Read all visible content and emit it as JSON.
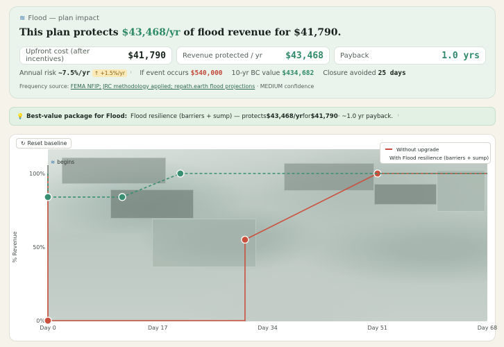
{
  "header": {
    "subtitle": "Flood — plan impact",
    "subtitle_icon": "wave-icon",
    "headline_pre": "This plan protects ",
    "headline_amount": "$43,468/yr",
    "headline_post": " of flood revenue for $41,790."
  },
  "stats": [
    {
      "label": "Upfront cost (after incentives)",
      "value": "$41,790"
    },
    {
      "label": "Revenue protected / yr",
      "value": "$43,468"
    },
    {
      "label": "Payback",
      "value": "1.0 yrs"
    }
  ],
  "metrics": {
    "annual_risk_label": "Annual risk",
    "annual_risk_value": "~7.5%/yr",
    "annual_risk_trend": "↑ +1.5%/yr",
    "event_label": "If event occurs",
    "event_value": "$540,000",
    "bc_label": "10-yr BC value",
    "bc_value": "$434,682",
    "closure_label": "Closure avoided",
    "closure_value": "25 days"
  },
  "source": {
    "prefix": "Frequency source: ",
    "link": "FEMA NFIP; JRC methodology applied; repath.earth flood projections",
    "suffix": " · MEDIUM confidence"
  },
  "banner": {
    "icon": "lightbulb-icon",
    "title": "Best-value package for Flood:",
    "text_pre": "Flood resilience (barriers + sump) — protects ",
    "amount": "$43,468/yr",
    "text_mid": " for ",
    "cost": "$41,790",
    "text_post": " · ~1.0 yr payback."
  },
  "chart_controls": {
    "reset_label": "Reset baseline",
    "reset_icon": "reset-icon"
  },
  "chart_data": {
    "type": "line",
    "xlabel": "",
    "ylabel": "% Revenue",
    "x_ticks": [
      "Day 0",
      "Day 17",
      "Day 34",
      "Day 51",
      "Day 68"
    ],
    "y_ticks": [
      "100%",
      "50%",
      "0%"
    ],
    "xlim": [
      0,
      68
    ],
    "ylim": [
      0,
      100
    ],
    "grid": false,
    "legend_position": "top-right",
    "event_marker": {
      "x": 0,
      "label": "begins",
      "icon": "wave-icon"
    },
    "series": [
      {
        "name": "Without upgrade",
        "color": "#c9503d",
        "style": "solid",
        "points": [
          [
            0,
            100
          ],
          [
            0,
            0
          ],
          [
            30.5,
            0
          ],
          [
            30.5,
            55
          ],
          [
            51,
            100
          ],
          [
            68,
            100
          ]
        ],
        "markers": [
          [
            0,
            0
          ],
          [
            30.5,
            55
          ],
          [
            51,
            100
          ]
        ]
      },
      {
        "name": "With Flood resilience (barriers + sump)",
        "color": "#3a8f73",
        "style": "dashed",
        "points": [
          [
            0,
            100
          ],
          [
            0,
            84
          ],
          [
            11.5,
            84
          ],
          [
            20.5,
            100
          ],
          [
            68,
            100
          ]
        ],
        "markers": [
          [
            0,
            84
          ],
          [
            11.5,
            84
          ],
          [
            20.5,
            100
          ]
        ]
      }
    ]
  }
}
